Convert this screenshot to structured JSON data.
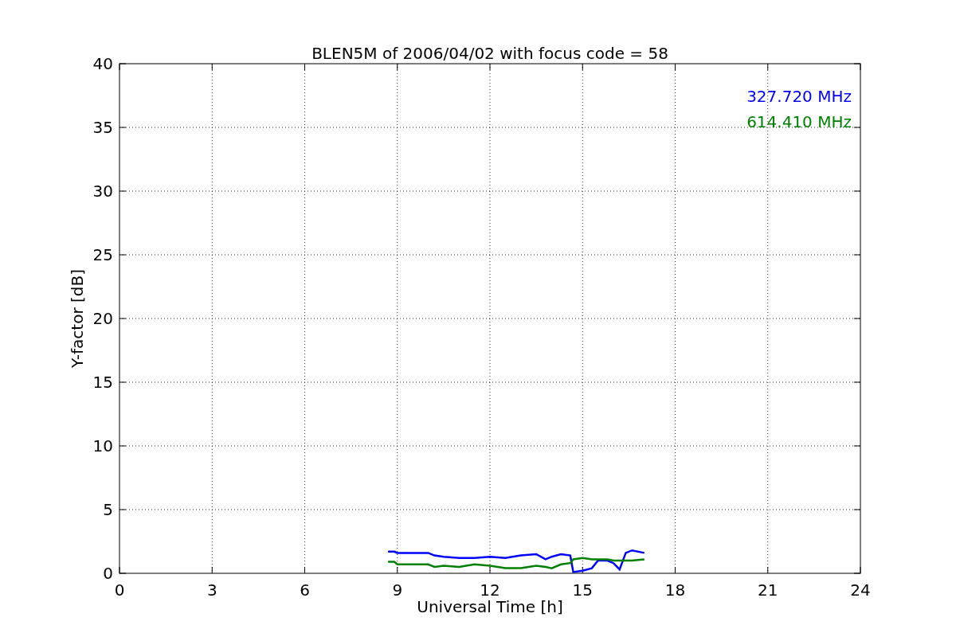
{
  "chart_data": {
    "type": "line",
    "title": "BLEN5M of 2006/04/02 with focus code = 58",
    "xlabel": "Universal Time [h]",
    "ylabel": "Y-factor [dB]",
    "x": [
      8.7,
      8.9,
      9.0,
      10.0,
      10.2,
      10.5,
      11,
      11.5,
      12,
      12.5,
      13,
      13.5,
      13.8,
      14,
      14.3,
      14.6,
      14.7,
      15,
      15.3,
      15.5,
      15.8,
      16,
      16.2,
      16.4,
      16.6,
      17
    ],
    "series": [
      {
        "name": "327.720 MHz",
        "color": "#0000ff",
        "values": [
          1.7,
          1.7,
          1.6,
          1.6,
          1.4,
          1.3,
          1.2,
          1.2,
          1.3,
          1.2,
          1.4,
          1.5,
          1.1,
          1.3,
          1.5,
          1.4,
          0.1,
          0.2,
          0.4,
          1.0,
          1.0,
          0.8,
          0.3,
          1.6,
          1.8,
          1.6
        ]
      },
      {
        "name": "614.410 MHz",
        "color": "#008000",
        "values": [
          0.9,
          0.9,
          0.7,
          0.7,
          0.5,
          0.6,
          0.5,
          0.7,
          0.6,
          0.4,
          0.4,
          0.6,
          0.5,
          0.4,
          0.7,
          0.8,
          1.1,
          1.2,
          1.1,
          1.1,
          1.1,
          1.0,
          1.0,
          1.0,
          1.0,
          1.1
        ]
      }
    ],
    "grid": true,
    "xlim": [
      0,
      24
    ],
    "ylim": [
      0,
      40
    ],
    "xticks": [
      0,
      3,
      6,
      9,
      12,
      15,
      18,
      21,
      24
    ],
    "yticks": [
      0,
      5,
      10,
      15,
      20,
      25,
      30,
      35,
      40
    ]
  }
}
